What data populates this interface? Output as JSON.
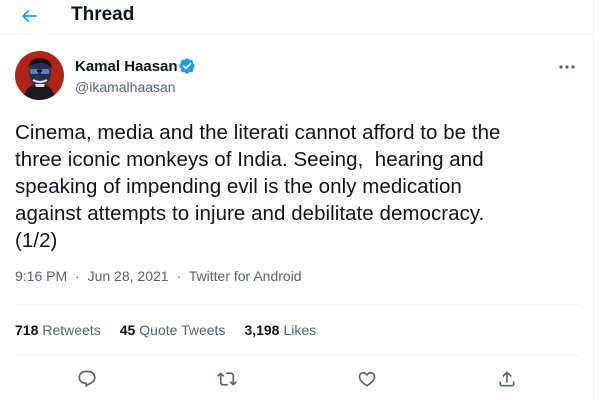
{
  "header": {
    "title": "Thread",
    "back_icon": "arrow-left-icon",
    "accent_color": "#1d9bf0"
  },
  "author": {
    "name": "Kamal Haasan",
    "handle": "@ikamalhaasan",
    "verified": true,
    "avatar_icon": "profile-avatar"
  },
  "tweet": {
    "text": "Cinema, media and the literati cannot afford to be the\nthree iconic monkeys of India. Seeing,  hearing and\nspeaking of impending evil is the only medication\nagainst attempts to injure and debilitate democracy.\n(1/2)",
    "time": "9:16 PM",
    "separator": "·",
    "date": "Jun 28, 2021",
    "source": "Twitter for Android"
  },
  "stats": {
    "retweets_count": "718",
    "retweets_label": "Retweets",
    "quotes_count": "45",
    "quotes_label": "Quote Tweets",
    "likes_count": "3,198",
    "likes_label": "Likes"
  },
  "actions": [
    "reply-icon",
    "retweet-icon",
    "like-icon",
    "share-icon"
  ],
  "colors": {
    "text_primary": "#0f1419",
    "text_secondary": "#536471",
    "divider": "#eff3f4",
    "verified_badge": "#1d9bf0"
  }
}
